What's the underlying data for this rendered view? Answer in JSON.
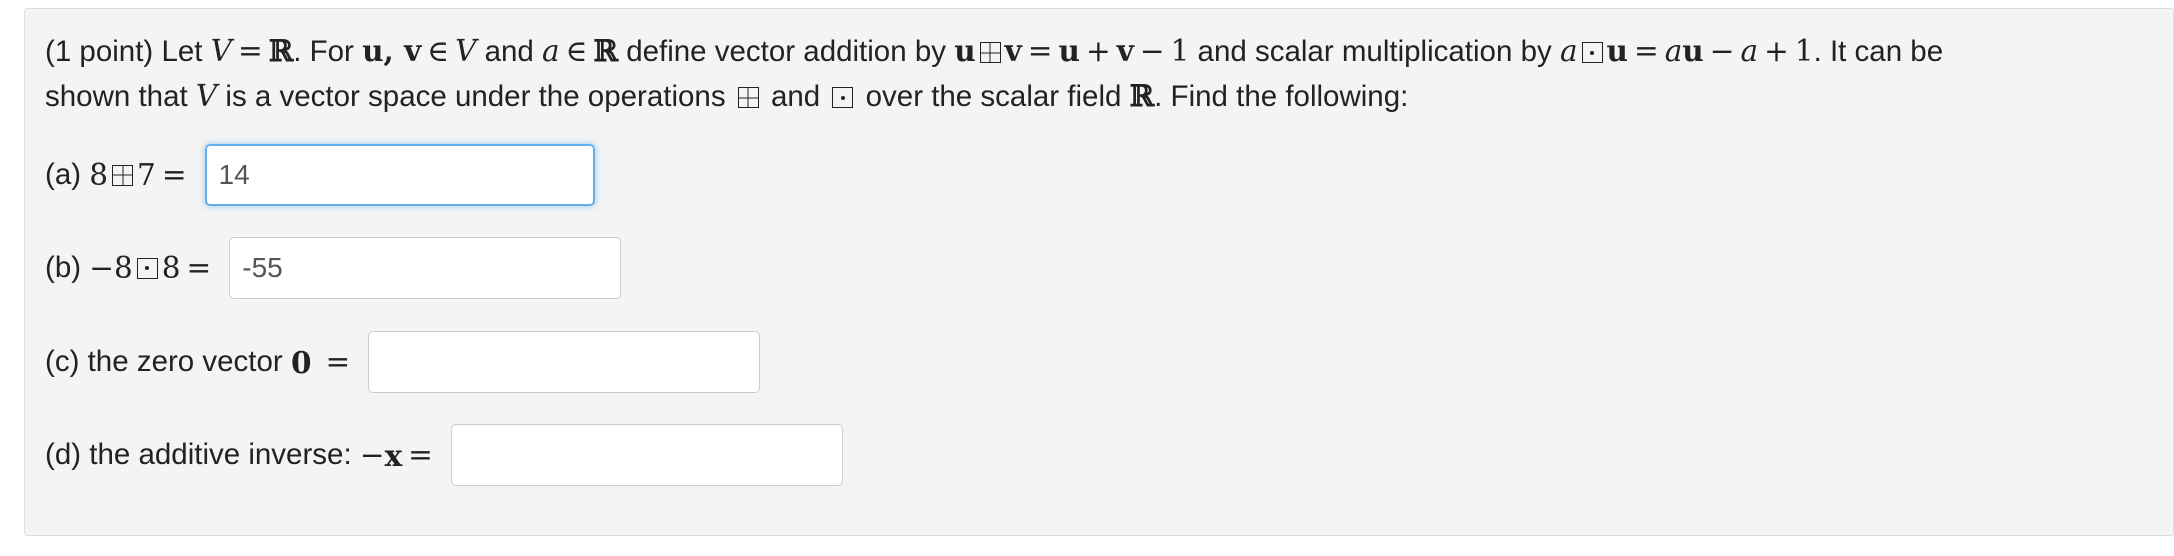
{
  "problem": {
    "points": "(1 point)",
    "t_let": "Let",
    "t_for": ". For",
    "t_and1": "and",
    "t_define": "define vector addition by",
    "t_scalar": "and scalar multiplication by",
    "t_itcan": ". It can be",
    "t_shown": "shown that",
    "t_isvs": "is a vector space under the operations",
    "t_and2": "and",
    "t_over": "over the scalar field",
    "t_find": ". Find the following:"
  },
  "questions": [
    {
      "label": "(a)",
      "expr_left": "8",
      "expr_right": "7",
      "value": "14",
      "placeholder": ""
    },
    {
      "label": "(b)",
      "expr_left": "−8",
      "expr_right": "8",
      "value": "-55",
      "placeholder": ""
    },
    {
      "label": "(c)",
      "text": "the zero vector",
      "symbol": "0",
      "value": "",
      "placeholder": ""
    },
    {
      "label": "(d)",
      "text": "the additive inverse:",
      "symbol": "x",
      "value": "",
      "placeholder": ""
    }
  ],
  "colors": {
    "focus_border": "#66afe9",
    "panel_bg": "#f4f4f4"
  }
}
